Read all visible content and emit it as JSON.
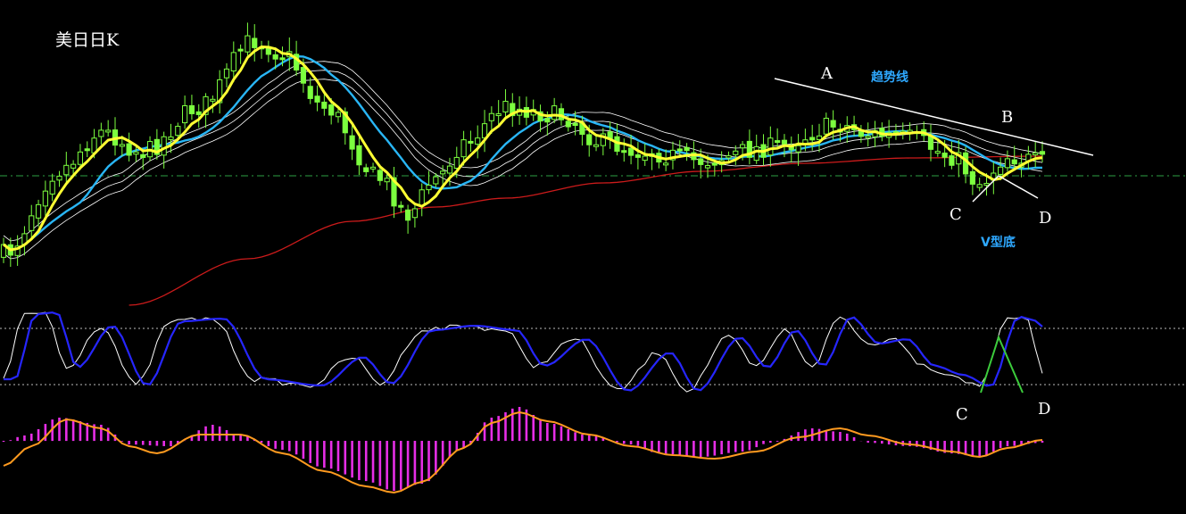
{
  "title": "美日日K",
  "colors": {
    "background": "#000000",
    "candle": "#7cff3f",
    "ma_yellow": "#ffff33",
    "ma_cyan": "#29b6f6",
    "ma_white": "#ffffff",
    "ma_red": "#cc1b1b",
    "kd_k": "#ffffff",
    "kd_d": "#2626ff",
    "macd_hist": "#e62ee6",
    "macd_line": "#ff9a1f",
    "baseline": "#2ea043",
    "dotted": "#bbbbbb",
    "annotation": "#ffffff",
    "annotation_blue": "#2ea8ff",
    "v_mark": "#3ccc3c"
  },
  "annotations": {
    "a": "A",
    "b": "B",
    "c_price": "C",
    "d_price": "D",
    "trendline_label": "趋势线",
    "v_label": "V型底",
    "c_kd": "C",
    "d_kd": "D"
  },
  "chart_data": [
    {
      "type": "candlestick",
      "name": "price",
      "title": "美日日K",
      "n_bars": 150,
      "overlays": [
        "ma_yellow",
        "ma_cyan",
        "ma_white_upper",
        "ma_white_lower",
        "ma_red"
      ],
      "annotations": [
        "A",
        "B",
        "C",
        "D",
        "趋势线",
        "V型底"
      ]
    },
    {
      "type": "line",
      "name": "kd",
      "series": [
        "K",
        "D"
      ],
      "ylim": [
        0,
        100
      ],
      "levels": [
        80,
        20
      ],
      "annotations": [
        "C",
        "D"
      ]
    },
    {
      "type": "bar",
      "name": "macd",
      "series": [
        "histogram",
        "signal"
      ]
    }
  ]
}
